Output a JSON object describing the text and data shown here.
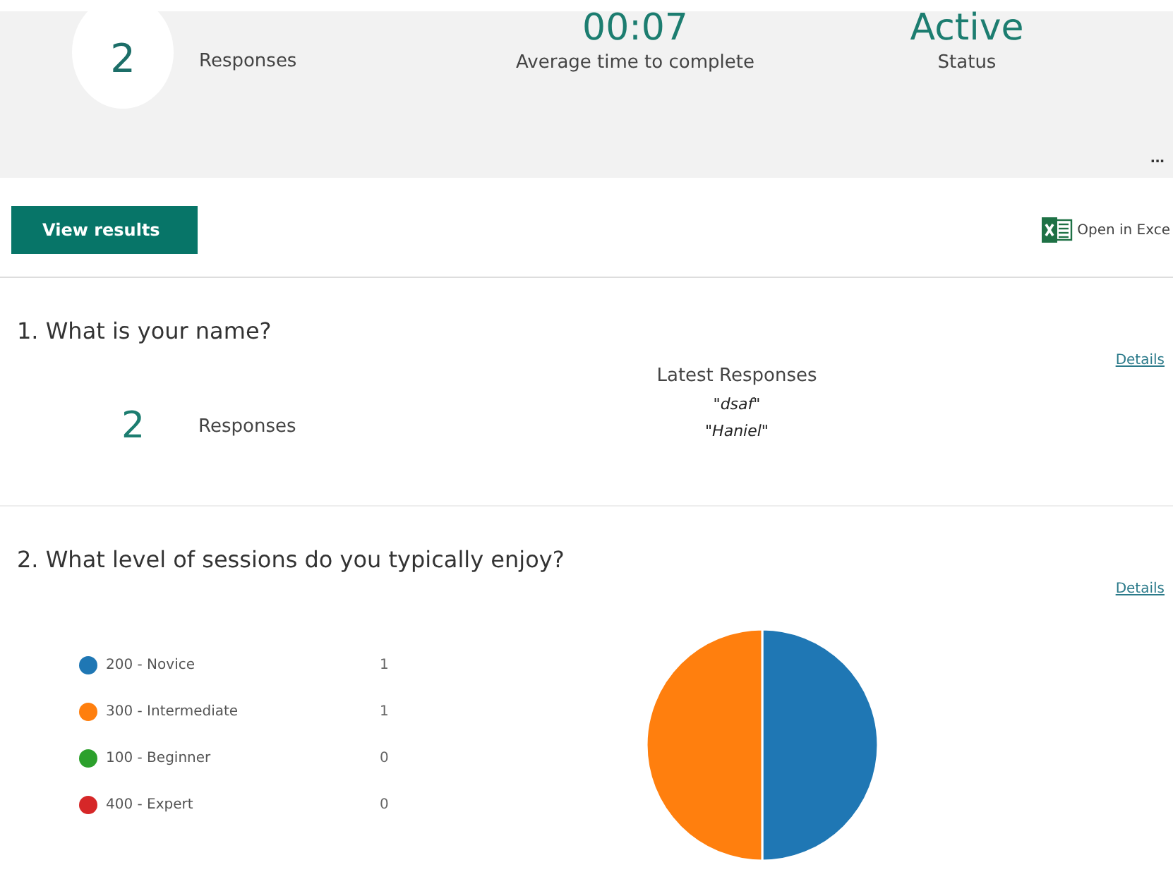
{
  "summary": {
    "responses_count": "2",
    "responses_label": "Responses",
    "avg_time": "00:07",
    "avg_time_label": "Average time to complete",
    "status": "Active",
    "status_label": "Status",
    "more": "..."
  },
  "actions": {
    "view_results": "View results",
    "open_excel": "Open in Exce"
  },
  "questions": [
    {
      "kind": "text",
      "title": "1.  What is your name?",
      "details": "Details",
      "count": "2",
      "count_label": "Responses",
      "latest_label": "Latest Responses",
      "latest": [
        "\"dsaf\"",
        "\"Haniel\""
      ]
    },
    {
      "kind": "choice",
      "title": "2.  What level of sessions do you typically enjoy?",
      "details": "Details",
      "legend": [
        {
          "label": "200 - Novice",
          "count": "1",
          "color": "#1f77b4"
        },
        {
          "label": "300 - Intermediate",
          "count": "1",
          "color": "#ff7f0e"
        },
        {
          "label": "100 - Beginner",
          "count": "0",
          "color": "#2ca02c"
        },
        {
          "label": "400 - Expert",
          "count": "0",
          "color": "#d62728"
        }
      ],
      "chart_data": {
        "type": "pie",
        "values": [
          50,
          50,
          0,
          0
        ]
      }
    }
  ]
}
